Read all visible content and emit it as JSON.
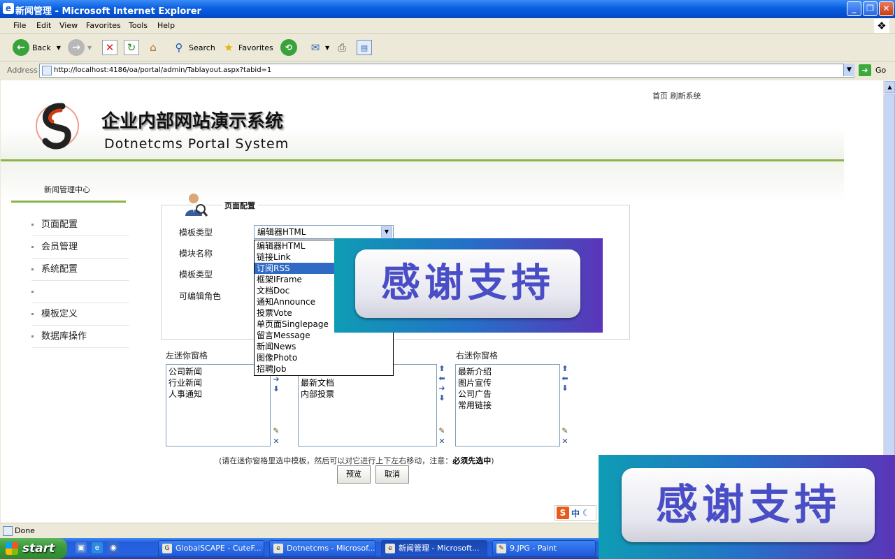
{
  "window": {
    "title": "新闻管理",
    "app": "- Microsoft Internet Explorer",
    "min_icon": "minimize-icon",
    "max_icon": "restore-icon",
    "close_icon": "close-icon"
  },
  "menu": [
    "File",
    "Edit",
    "View",
    "Favorites",
    "Tools",
    "Help"
  ],
  "toolbar": {
    "back": "Back",
    "search": "Search",
    "favorites": "Favorites"
  },
  "address": {
    "label": "Address",
    "url": "http://localhost:4186/oa/portal/admin/Tablayout.aspx?tabid=1",
    "go": "Go"
  },
  "site": {
    "title_cn": "企业内部网站演示系统",
    "title_en": "Dotnetcms Portal System",
    "top_links": "首页  刷新系统"
  },
  "sidebar": {
    "title": "新闻管理中心",
    "items": [
      "页面配置",
      "会员管理",
      "系统配置",
      "",
      "模板定义",
      "数据库操作"
    ]
  },
  "form": {
    "legend": "页面配置",
    "labels": [
      "模板类型",
      "模块名称",
      "模板类型",
      "可编辑角色"
    ],
    "select_value": "编辑器HTML",
    "options": [
      "编辑器HTML",
      "链接Link",
      "订阅RSS",
      "框架IFrame",
      "文档Doc",
      "通知Announce",
      "投票Vote",
      "单页面Singlepage",
      "留言Message",
      "新闻News",
      "图像Photo",
      "招聘Job"
    ],
    "selected_index": 2
  },
  "panes": {
    "left_label": "左迷你窗格",
    "right_label": "右迷你窗格",
    "left_items": [
      "公司新闻",
      "行业新闻",
      "人事通知"
    ],
    "center_items": [
      "最新文档",
      "内部投票"
    ],
    "right_items": [
      "最新介绍",
      "图片宣传",
      "公司广告",
      "常用链接"
    ]
  },
  "hint": {
    "text": "(请在迷你窗格里选中模板，然后可以对它进行上下左右移动，注意：",
    "bold": "必须先选中",
    "end": ")"
  },
  "buttons": {
    "preview": "预览",
    "cancel": "取消"
  },
  "ime": {
    "s": "S",
    "lang": "中"
  },
  "overlay": {
    "text": "感谢支持"
  },
  "status": {
    "text": "Done"
  },
  "taskbar": {
    "start": "start",
    "tasks": [
      "GlobalSCAPE - CuteF...",
      "Dotnetcms - Microsof...",
      "新闻管理 - Microsoft...",
      "9.JPG - Paint"
    ]
  }
}
